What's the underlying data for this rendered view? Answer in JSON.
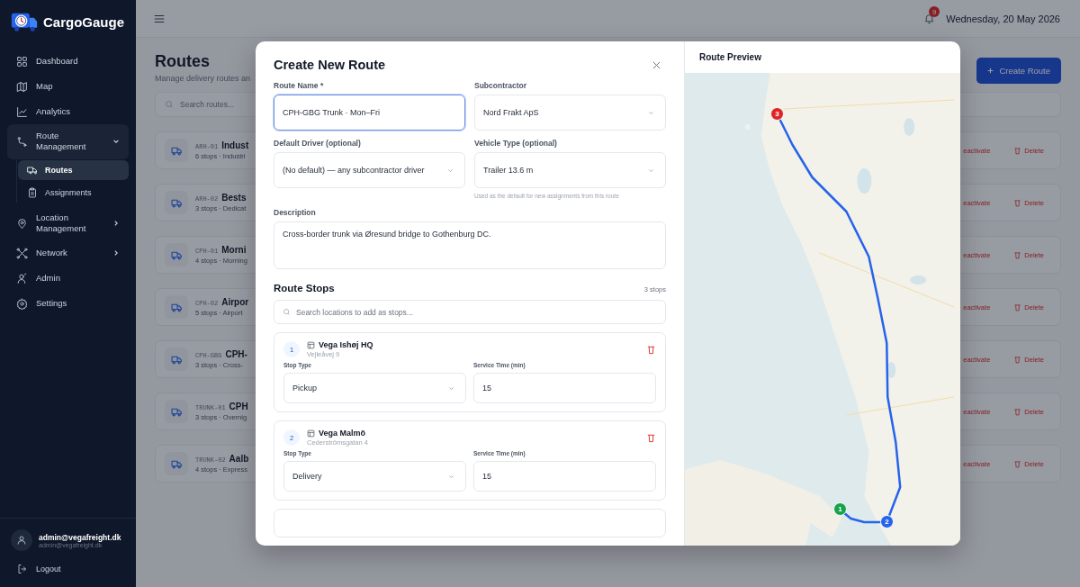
{
  "app": {
    "name": "CargoGauge"
  },
  "sidebar": {
    "items": [
      {
        "label": "Dashboard",
        "selected": false
      },
      {
        "label": "Map",
        "selected": false
      },
      {
        "label": "Analytics",
        "selected": false
      },
      {
        "label": "Route Management",
        "selected": false,
        "expanded": true,
        "children": [
          {
            "label": "Routes",
            "selected": true
          },
          {
            "label": "Assignments",
            "selected": false
          }
        ]
      },
      {
        "label": "Location Management",
        "selected": false,
        "expanded": false
      },
      {
        "label": "Network",
        "selected": false,
        "expanded": false
      },
      {
        "label": "Admin",
        "selected": false
      },
      {
        "label": "Settings",
        "selected": false
      }
    ],
    "user": {
      "name": "admin@vegafreight.dk",
      "email": "admin@vegafreight.dk"
    },
    "logout": "Logout"
  },
  "header": {
    "notifications": "9",
    "date": "Wednesday, 20 May 2026"
  },
  "page": {
    "title": "Routes",
    "subtitle": "Manage delivery routes an",
    "search": {
      "placeholder": "Search routes..."
    },
    "create_button": "Create Route",
    "routes": [
      {
        "code": "ARH-01",
        "name": "Indust",
        "summary": "6 stops · Industri",
        "actions": [
          "eactivate",
          "Delete"
        ]
      },
      {
        "code": "ARH-02",
        "name": "Bests",
        "summary": "3 stops · Dedicat",
        "actions": [
          "eactivate",
          "Delete"
        ]
      },
      {
        "code": "CPH-01",
        "name": "Morni",
        "summary": "4 stops · Morning",
        "actions": [
          "eactivate",
          "Delete"
        ]
      },
      {
        "code": "CPH-02",
        "name": "Airpor",
        "summary": "5 stops · Airport",
        "actions": [
          "eactivate",
          "Delete"
        ]
      },
      {
        "code": "CPH-GBG",
        "name": "CPH-",
        "summary": "3 stops · Cross-",
        "actions": [
          "eactivate",
          "Delete"
        ]
      },
      {
        "code": "TRUNK-01",
        "name": "CPH",
        "summary": "3 stops · Overnig",
        "actions": [
          "eactivate",
          "Delete"
        ]
      },
      {
        "code": "TRUNK-02",
        "name": "Aalb",
        "summary": "4 stops · Express",
        "actions": [
          "eactivate",
          "Delete"
        ]
      }
    ]
  },
  "modal": {
    "title": "Create New Route",
    "fields": [
      {
        "kind": "input",
        "label": "Route Name *",
        "value": "CPH-GBG Trunk · Mon–Fri",
        "focused": true
      },
      {
        "kind": "select",
        "label": "Subcontractor",
        "value": "Nord Frakt ApS",
        "focused": false
      },
      {
        "kind": "select",
        "label": "Default Driver (optional)",
        "value": "(No default) — any subcontractor driver",
        "focused": false
      },
      {
        "kind": "select",
        "label": "Vehicle Type (optional)",
        "value": "Trailer 13.6 m",
        "focused": false,
        "hint": "Used as the default for new assignments from this route"
      }
    ],
    "description": {
      "label": "Description",
      "value": "Cross-border trunk via Øresund bridge to Gothenburg DC."
    },
    "stops_section": {
      "title": "Route Stops",
      "count": "3 stops",
      "search": {
        "placeholder": "Search locations to add as stops..."
      },
      "stops": [
        {
          "number": "1",
          "name": "Vega Ishøj HQ",
          "address": "Vejleåvej 9",
          "type_label": "Stop Type",
          "type": "Pickup",
          "time_label": "Service Time (min)",
          "time": "15"
        },
        {
          "number": "2",
          "name": "Vega Malmö",
          "address": "Cederströmsgatan 4",
          "type_label": "Stop Type",
          "type": "Delivery",
          "time_label": "Service Time (min)",
          "time": "15"
        }
      ]
    },
    "preview": {
      "title": "Route Preview",
      "markers": [
        {
          "label": "3",
          "color": "#dc2626"
        },
        {
          "label": "1",
          "color": "#16a34a"
        },
        {
          "label": "2",
          "color": "#2563eb"
        }
      ]
    }
  }
}
